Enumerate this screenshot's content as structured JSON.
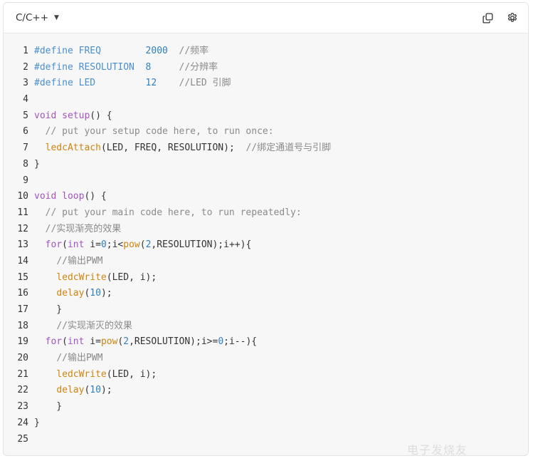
{
  "header": {
    "language": "C/C++",
    "caret_glyph": "▼",
    "copy_icon": "copy-icon",
    "settings_icon": "gear-icon"
  },
  "colors": {
    "preprocessor": "#4a8fd0",
    "number": "#2e7fc4",
    "comment": "#8a8a8a",
    "keyword": "#a453c1",
    "function": "#cf8410",
    "text": "#333333",
    "background": "#f7f7f7"
  },
  "lines": [
    {
      "n": "1",
      "tokens": [
        {
          "t": "#define FREQ        ",
          "c": "pre"
        },
        {
          "t": "2000",
          "c": "num"
        },
        {
          "t": "  "
        },
        {
          "t": "//频率",
          "c": "com"
        }
      ]
    },
    {
      "n": "2",
      "tokens": [
        {
          "t": "#define RESOLUTION  ",
          "c": "pre"
        },
        {
          "t": "8",
          "c": "num"
        },
        {
          "t": "     "
        },
        {
          "t": "//分辨率",
          "c": "com"
        }
      ]
    },
    {
      "n": "3",
      "tokens": [
        {
          "t": "#define LED         ",
          "c": "pre"
        },
        {
          "t": "12",
          "c": "num"
        },
        {
          "t": "    "
        },
        {
          "t": "//LED 引脚",
          "c": "com"
        }
      ]
    },
    {
      "n": "4",
      "tokens": []
    },
    {
      "n": "5",
      "tokens": [
        {
          "t": "void",
          "c": "kw"
        },
        {
          "t": " "
        },
        {
          "t": "setup",
          "c": "fnp"
        },
        {
          "t": "() {"
        }
      ]
    },
    {
      "n": "6",
      "tokens": [
        {
          "t": "  "
        },
        {
          "t": "// put your setup code here, to run once:",
          "c": "com"
        }
      ]
    },
    {
      "n": "7",
      "tokens": [
        {
          "t": "  "
        },
        {
          "t": "ledcAttach",
          "c": "fn"
        },
        {
          "t": "(LED, FREQ, RESOLUTION);  "
        },
        {
          "t": "//绑定通道号与引脚",
          "c": "com"
        }
      ]
    },
    {
      "n": "8",
      "tokens": [
        {
          "t": "}"
        }
      ]
    },
    {
      "n": "9",
      "tokens": []
    },
    {
      "n": "10",
      "tokens": [
        {
          "t": "void",
          "c": "kw"
        },
        {
          "t": " "
        },
        {
          "t": "loop",
          "c": "fnp"
        },
        {
          "t": "() {"
        }
      ]
    },
    {
      "n": "11",
      "tokens": [
        {
          "t": "  "
        },
        {
          "t": "// put your main code here, to run repeatedly:",
          "c": "com"
        }
      ]
    },
    {
      "n": "12",
      "tokens": [
        {
          "t": "  "
        },
        {
          "t": "//实现渐亮的效果",
          "c": "com"
        }
      ]
    },
    {
      "n": "13",
      "tokens": [
        {
          "t": "  "
        },
        {
          "t": "for",
          "c": "kw"
        },
        {
          "t": "("
        },
        {
          "t": "int",
          "c": "kw"
        },
        {
          "t": " i="
        },
        {
          "t": "0",
          "c": "num"
        },
        {
          "t": ";i<"
        },
        {
          "t": "pow",
          "c": "fn"
        },
        {
          "t": "("
        },
        {
          "t": "2",
          "c": "num"
        },
        {
          "t": ",RESOLUTION);i++){"
        }
      ]
    },
    {
      "n": "14",
      "tokens": [
        {
          "t": "    "
        },
        {
          "t": "//输出PWM",
          "c": "com"
        }
      ]
    },
    {
      "n": "15",
      "tokens": [
        {
          "t": "    "
        },
        {
          "t": "ledcWrite",
          "c": "fn"
        },
        {
          "t": "(LED, i);"
        }
      ]
    },
    {
      "n": "16",
      "tokens": [
        {
          "t": "    "
        },
        {
          "t": "delay",
          "c": "fn"
        },
        {
          "t": "("
        },
        {
          "t": "10",
          "c": "num"
        },
        {
          "t": ");"
        }
      ]
    },
    {
      "n": "17",
      "tokens": [
        {
          "t": "    }"
        }
      ]
    },
    {
      "n": "18",
      "tokens": [
        {
          "t": "    "
        },
        {
          "t": "//实现渐灭的效果",
          "c": "com"
        }
      ]
    },
    {
      "n": "19",
      "tokens": [
        {
          "t": "  "
        },
        {
          "t": "for",
          "c": "kw"
        },
        {
          "t": "("
        },
        {
          "t": "int",
          "c": "kw"
        },
        {
          "t": " i="
        },
        {
          "t": "pow",
          "c": "fn"
        },
        {
          "t": "("
        },
        {
          "t": "2",
          "c": "num"
        },
        {
          "t": ",RESOLUTION);i>="
        },
        {
          "t": "0",
          "c": "num"
        },
        {
          "t": ";i--){"
        }
      ]
    },
    {
      "n": "20",
      "tokens": [
        {
          "t": "    "
        },
        {
          "t": "//输出PWM",
          "c": "com"
        }
      ]
    },
    {
      "n": "21",
      "tokens": [
        {
          "t": "    "
        },
        {
          "t": "ledcWrite",
          "c": "fn"
        },
        {
          "t": "(LED, i);"
        }
      ]
    },
    {
      "n": "22",
      "tokens": [
        {
          "t": "    "
        },
        {
          "t": "delay",
          "c": "fn"
        },
        {
          "t": "("
        },
        {
          "t": "10",
          "c": "num"
        },
        {
          "t": ");"
        }
      ]
    },
    {
      "n": "23",
      "tokens": [
        {
          "t": "    }"
        }
      ]
    },
    {
      "n": "24",
      "tokens": [
        {
          "t": "}"
        }
      ]
    },
    {
      "n": "25",
      "tokens": []
    }
  ],
  "watermark": "电子发烧友"
}
